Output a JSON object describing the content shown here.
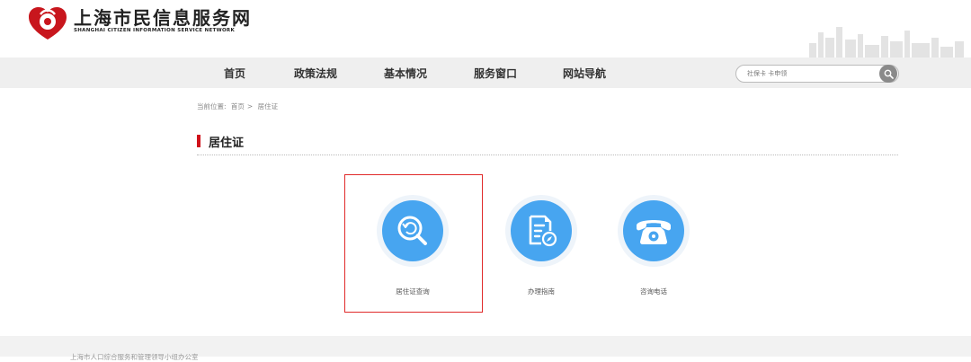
{
  "header": {
    "title": "上海市民信息服务网",
    "subtitle": "SHANGHAI CITIZEN INFORMATION SERVICE NETWORK"
  },
  "nav": {
    "items": [
      {
        "label": "首页"
      },
      {
        "label": "政策法规"
      },
      {
        "label": "基本情况"
      },
      {
        "label": "服务窗口"
      },
      {
        "label": "网站导航"
      }
    ]
  },
  "search": {
    "placeholder": "社保卡 卡申领"
  },
  "breadcrumb": {
    "prefix": "当前位置:",
    "home": "首页",
    "separator": ">",
    "current": "居住证"
  },
  "section": {
    "title": "居住证"
  },
  "services": [
    {
      "label": "居住证查询",
      "icon": "search-refresh-icon"
    },
    {
      "label": "办理指南",
      "icon": "guide-document-icon"
    },
    {
      "label": "咨询电话",
      "icon": "telephone-icon"
    }
  ],
  "footer": {
    "text": "上海市人口综合服务和管理领导小组办公室"
  },
  "colors": {
    "accent_red": "#d0121b",
    "service_blue": "#47a5f0",
    "highlight_border": "#e02a2a",
    "nav_background": "#efefef"
  }
}
